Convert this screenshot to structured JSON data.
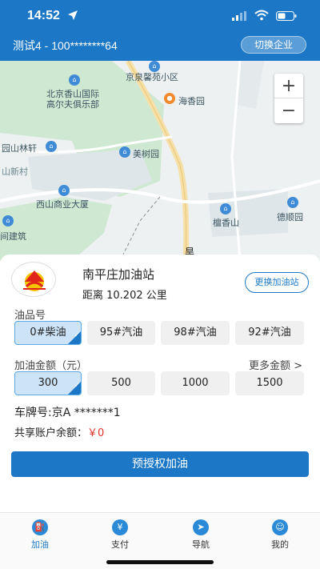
{
  "status_bar": {
    "time": "14:52"
  },
  "header": {
    "company": "测试4 - 100********64",
    "switch_label": "切换企业"
  },
  "map": {
    "labels": {
      "l1": "北京香山国际",
      "l2": "高尔夫俱乐部",
      "l3": "京泉馨苑小区",
      "l4": "海香园",
      "l5": "园山林轩",
      "l6": "美树园",
      "l7": "山新村",
      "l8": "西山商业大厦",
      "l9": "檀香山",
      "l10": "德顺园",
      "l11": "间建筑",
      "l12": "旱"
    },
    "zoom_in": "+",
    "zoom_out": "−"
  },
  "station": {
    "name": "南平庄加油站",
    "distance": "距离 10.202 公里",
    "change_label": "更换加油站"
  },
  "fuel": {
    "label": "油品号",
    "options": [
      "0#柴油",
      "95#汽油",
      "98#汽油",
      "92#汽油"
    ],
    "selected": "0#柴油"
  },
  "amount": {
    "label": "加油金额（元）",
    "more_label": "更多金额 >",
    "options": [
      "300",
      "500",
      "1000",
      "1500"
    ],
    "selected": "300"
  },
  "plate": "车牌号:京A *******1",
  "balance": {
    "label": "共享账户余额：",
    "value": "￥0"
  },
  "primary_button": "预授权加油",
  "tabs": [
    {
      "label": "加油",
      "icon": "fuel-icon",
      "active": true
    },
    {
      "label": "支付",
      "icon": "pay-icon",
      "active": false
    },
    {
      "label": "导航",
      "icon": "navigation-icon",
      "active": false
    },
    {
      "label": "我的",
      "icon": "profile-icon",
      "active": false
    }
  ],
  "colors": {
    "brand": "#1c78c6",
    "selected_bg": "#cde3f7",
    "balance": "#e0302c"
  }
}
